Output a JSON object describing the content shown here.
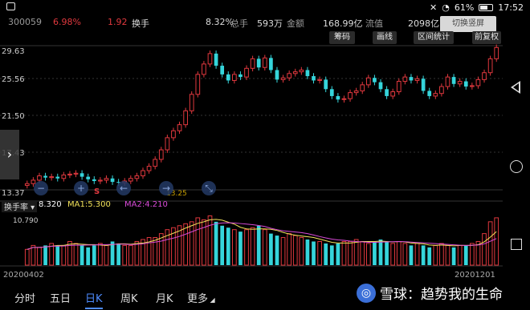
{
  "status_bar": {
    "battery": "61%",
    "time": "17:52"
  },
  "quote": {
    "code": "300059",
    "change_pct": "6.98%",
    "change": "1.92",
    "turnover_label": "换手",
    "turnover": "8.32%",
    "volume_label": "总手",
    "volume": "593万",
    "amount_label": "金额",
    "amount": "168.99亿",
    "float_label": "流值",
    "float_value": "2098亿",
    "landscape_btn": "切换竖屏"
  },
  "toolbar": [
    "筹码",
    "画线",
    "区间统计",
    "前复权"
  ],
  "price_axis": [
    "29.63",
    "25.56",
    "21.50",
    "17.43",
    "13.37"
  ],
  "markers": {
    "s": "S",
    "low": "13.25",
    "high": "29.63"
  },
  "indicator": {
    "name": "换手率",
    "value": "8.320",
    "ma1": "MA1:5.300",
    "ma2": "MA2:4.210",
    "max": "10.790"
  },
  "dates": {
    "start": "20200402",
    "end": "20201201"
  },
  "tabs": [
    "分时",
    "五日",
    "日K",
    "周K",
    "月K",
    "更多"
  ],
  "watermark": "雪球：趋势我的生命",
  "colors": {
    "up": "#e0383e",
    "down": "#35d5db",
    "ma_yellow": "#f2e25a",
    "ma_purple": "#d84ad8"
  },
  "chart_data": {
    "type": "candlestick",
    "y_range": [
      13.37,
      29.63
    ],
    "x_range": [
      "20200402",
      "20201201"
    ],
    "series": [
      {
        "values": [
          13.9,
          14.3,
          14.8,
          14.6,
          14.7,
          14.5,
          14.9,
          15.0,
          15.1,
          14.7,
          14.4,
          14.2,
          14.3,
          14.5,
          14.1,
          14.0,
          14.2,
          14.5,
          14.8,
          15.4,
          15.9,
          16.7,
          17.8,
          19.2,
          20.0,
          20.7,
          22.3,
          24.2,
          26.5,
          27.7,
          28.9,
          27.5,
          26.5,
          25.8,
          26.5,
          26.2,
          27.2,
          28.3,
          27.3,
          28.4,
          27.0,
          25.9,
          26.1,
          26.6,
          26.8,
          27.0,
          26.3,
          25.8,
          25.9,
          24.8,
          24.0,
          23.6,
          23.7,
          24.4,
          24.6,
          25.3,
          26.1,
          25.6,
          24.8,
          24.0,
          24.5,
          25.7,
          26.2,
          25.8,
          26.0,
          24.6,
          24.0,
          24.3,
          25.1,
          26.2,
          25.4,
          25.7,
          25.1,
          25.2,
          25.9,
          26.7,
          28.3,
          29.6
        ]
      },
      {
        "values": [
          0.4,
          0.5,
          0.45,
          0.5,
          0.55,
          0.5,
          0.5,
          0.6,
          0.55,
          0.5,
          0.45,
          0.5,
          0.55,
          0.5,
          0.6,
          0.55,
          0.5,
          0.5,
          0.6,
          0.65,
          0.7,
          0.7,
          0.8,
          0.9,
          0.95,
          1.0,
          1.05,
          1.1,
          1.2,
          1.15,
          1.25,
          1.1,
          1.0,
          0.95,
          0.9,
          0.85,
          0.9,
          0.95,
          1.0,
          0.9,
          0.8,
          0.75,
          0.7,
          0.8,
          0.75,
          0.7,
          0.65,
          0.6,
          0.6,
          0.55,
          0.5,
          0.55,
          0.6,
          0.6,
          0.65,
          0.6,
          0.55,
          0.6,
          0.65,
          0.6,
          0.55,
          0.6,
          0.55,
          0.5,
          0.55,
          0.5,
          0.45,
          0.5,
          0.55,
          0.5,
          0.45,
          0.5,
          0.5,
          0.55,
          0.6,
          0.8,
          1.1,
          1.2
        ]
      }
    ]
  }
}
